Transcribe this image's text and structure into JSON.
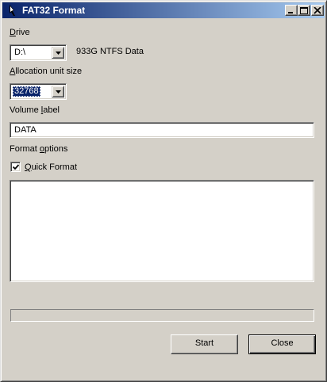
{
  "window": {
    "title": "FAT32 Format",
    "icon": "pen-app-icon",
    "controls": [
      "minimize-icon",
      "maximize-icon",
      "close-icon"
    ]
  },
  "drive": {
    "label": "Drive",
    "label_accesskey": "D",
    "label_rest": "rive",
    "selected": "D:\\",
    "info": "933G NTFS Data"
  },
  "allocation": {
    "label": "Allocation unit size",
    "label_accesskey": "A",
    "label_rest": "llocation unit size",
    "selected": "32768"
  },
  "volume": {
    "label": "Volume label",
    "label_pre": "Volume ",
    "label_accesskey": "l",
    "label_rest": "abel",
    "value": "DATA"
  },
  "format_options": {
    "label": "Format options",
    "label_pre": "Format ",
    "label_accesskey": "o",
    "label_rest": "ptions",
    "quick_format": {
      "label": "Quick Format",
      "label_accesskey": "Q",
      "label_rest": "uick Format",
      "checked": true
    }
  },
  "log_output": "",
  "progress": {
    "percent": 0
  },
  "buttons": {
    "start": "Start",
    "close": "Close"
  },
  "colors": {
    "face": "#d4d0c8",
    "title_start": "#0a246a",
    "title_end": "#a6caf0",
    "selection": "#0a246a"
  }
}
